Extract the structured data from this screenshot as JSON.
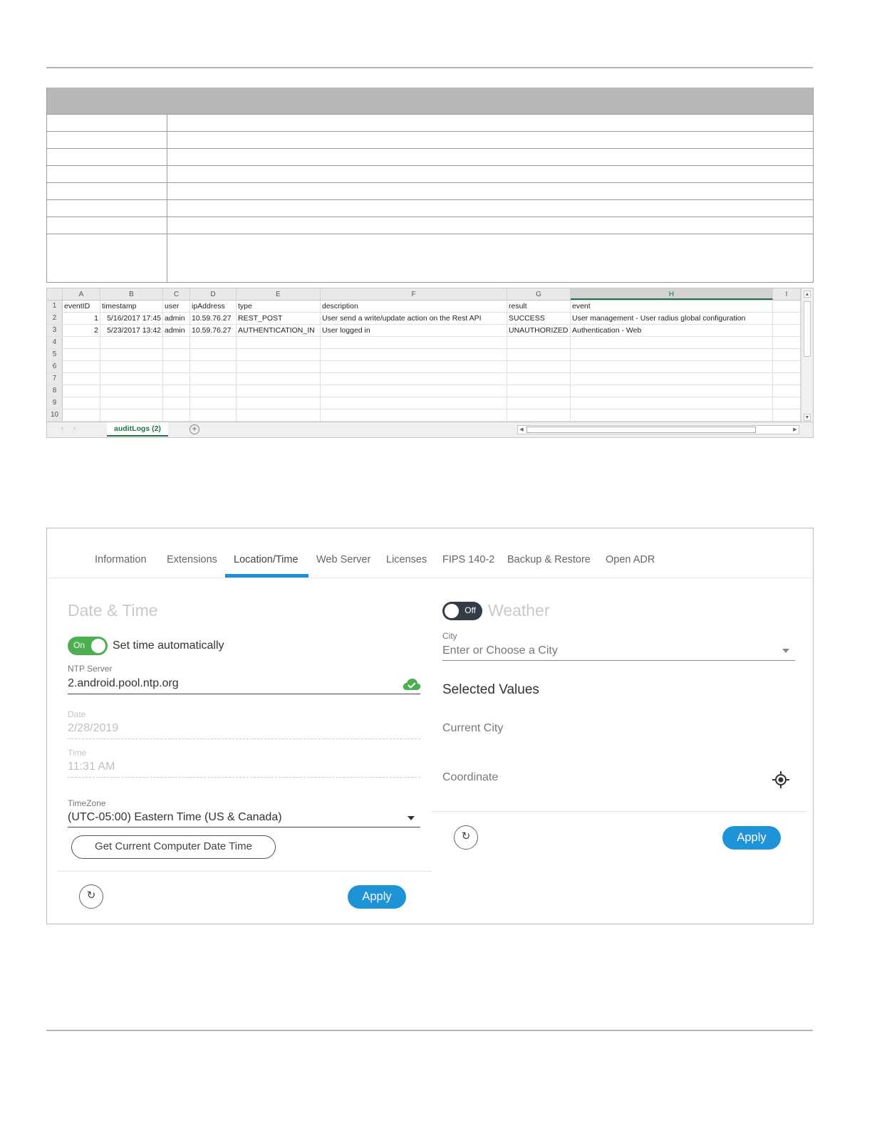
{
  "spreadsheet": {
    "columns": [
      "A",
      "B",
      "C",
      "D",
      "E",
      "F",
      "G",
      "H",
      "I"
    ],
    "row_numbers": [
      "1",
      "2",
      "3",
      "4",
      "5",
      "6",
      "7",
      "8",
      "9",
      "10"
    ],
    "rows": [
      [
        "eventID",
        "timestamp",
        "user",
        "ipAddress",
        "type",
        "description",
        "result",
        "event",
        ""
      ],
      [
        "1",
        "5/16/2017 17:45",
        "admin",
        "10.59.76.27",
        "REST_POST",
        "User send a write/update action on the Rest API",
        "SUCCESS",
        "User management - User radius global configuration",
        ""
      ],
      [
        "2",
        "5/23/2017 13:42",
        "admin",
        "10.59.76.27",
        "AUTHENTICATION_IN",
        "User logged in",
        "UNAUTHORIZED",
        "Authentication - Web",
        ""
      ]
    ],
    "sheet_tab": "auditLogs (2)",
    "selected_column": "H"
  },
  "settings": {
    "tabs": [
      "Information",
      "Extensions",
      "Location/Time",
      "Web Server",
      "Licenses",
      "FIPS 140-2",
      "Backup & Restore",
      "Open ADR"
    ],
    "active_tab": "Location/Time",
    "date_time": {
      "title": "Date & Time",
      "auto_toggle_label": "On",
      "auto_label": "Set time automatically",
      "ntp_label": "NTP Server",
      "ntp_value": "2.android.pool.ntp.org",
      "date_label": "Date",
      "date_value": "2/28/2019",
      "time_label": "Time",
      "time_value": "11:31 AM",
      "timezone_label": "TimeZone",
      "timezone_value": "(UTC-05:00) Eastern Time (US & Canada)",
      "get_current_button": "Get Current Computer Date Time",
      "apply_button": "Apply"
    },
    "weather": {
      "toggle_label": "Off",
      "title": "Weather",
      "city_label": "City",
      "city_placeholder": "Enter or Choose a City",
      "selected_values_title": "Selected Values",
      "current_city_label": "Current City",
      "coordinate_label": "Coordinate",
      "apply_button": "Apply"
    }
  },
  "colors": {
    "accent_blue": "#1e93d6",
    "toggle_green": "#4caf50",
    "excel_green": "#217346"
  }
}
